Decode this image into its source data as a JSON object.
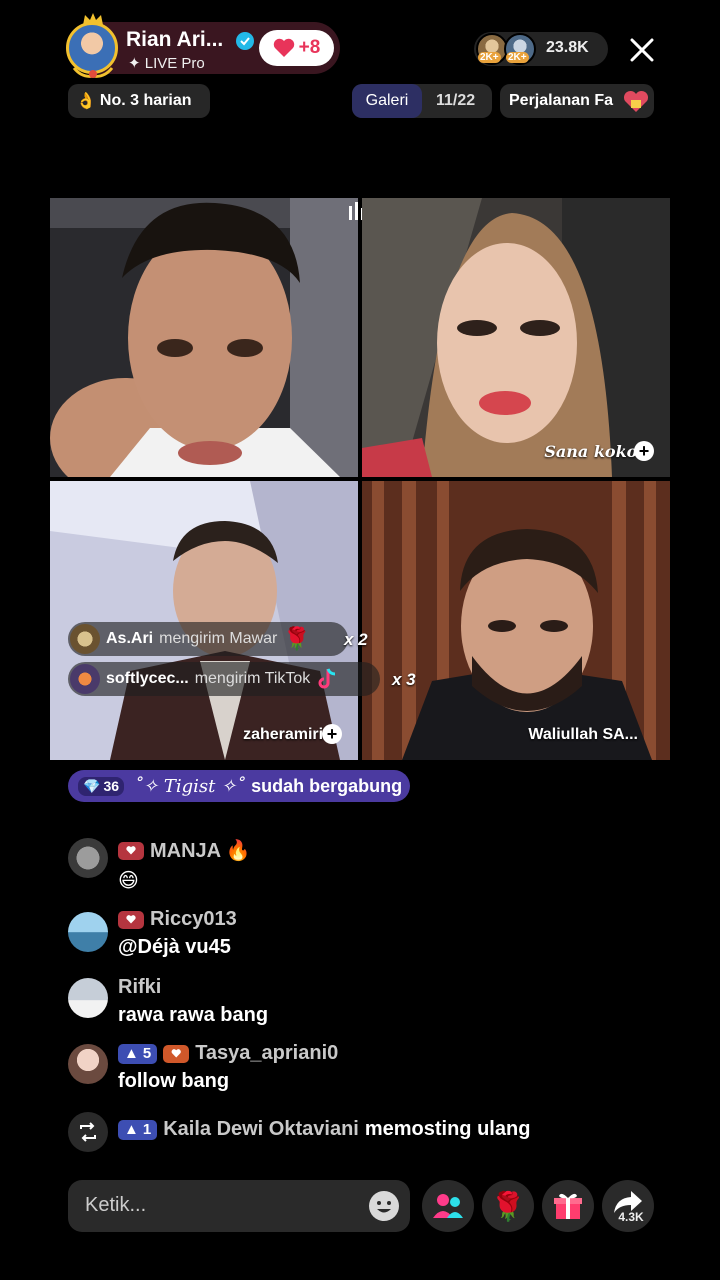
{
  "host": {
    "name": "Rian Ari...",
    "subtitle": "✦ LIVE Pro",
    "likes": "+8"
  },
  "viewers": {
    "count": "23.8K",
    "badge1": "2K+",
    "badge2": "2K+"
  },
  "chips": {
    "rank": "No. 3 harian",
    "gallery_label": "Galeri",
    "gallery_count": "11/22",
    "journey": "Perjalanan Fa"
  },
  "tiles": {
    "tile2_name": "Sana koko-",
    "tile3_name": "zaheramiri6",
    "tile4_name": "Waliullah SA..."
  },
  "gifts": [
    {
      "user": "As.Ari",
      "action": "mengirim Mawar",
      "mult": "x 2"
    },
    {
      "user": "softlycec...",
      "action": "mengirim TikTok",
      "mult": "x 3"
    }
  ],
  "join": {
    "level": "36",
    "name": "˚✧ Tigist ✧˚",
    "text": "sudah bergabung"
  },
  "chat": [
    {
      "user": "MANJA 🔥",
      "message": "😄"
    },
    {
      "user": "Riccy013",
      "message": "@Déjà vu45"
    },
    {
      "user": "Rifki",
      "message": "rawa rawa bang"
    },
    {
      "user": "Tasya_apriani0",
      "level": "5",
      "message": "follow bang"
    }
  ],
  "repost": {
    "level": "1",
    "user": "Kaila Dewi Oktaviani",
    "text": "memosting ulang"
  },
  "input": {
    "placeholder": "Ketik..."
  },
  "share_count": "4.3K"
}
